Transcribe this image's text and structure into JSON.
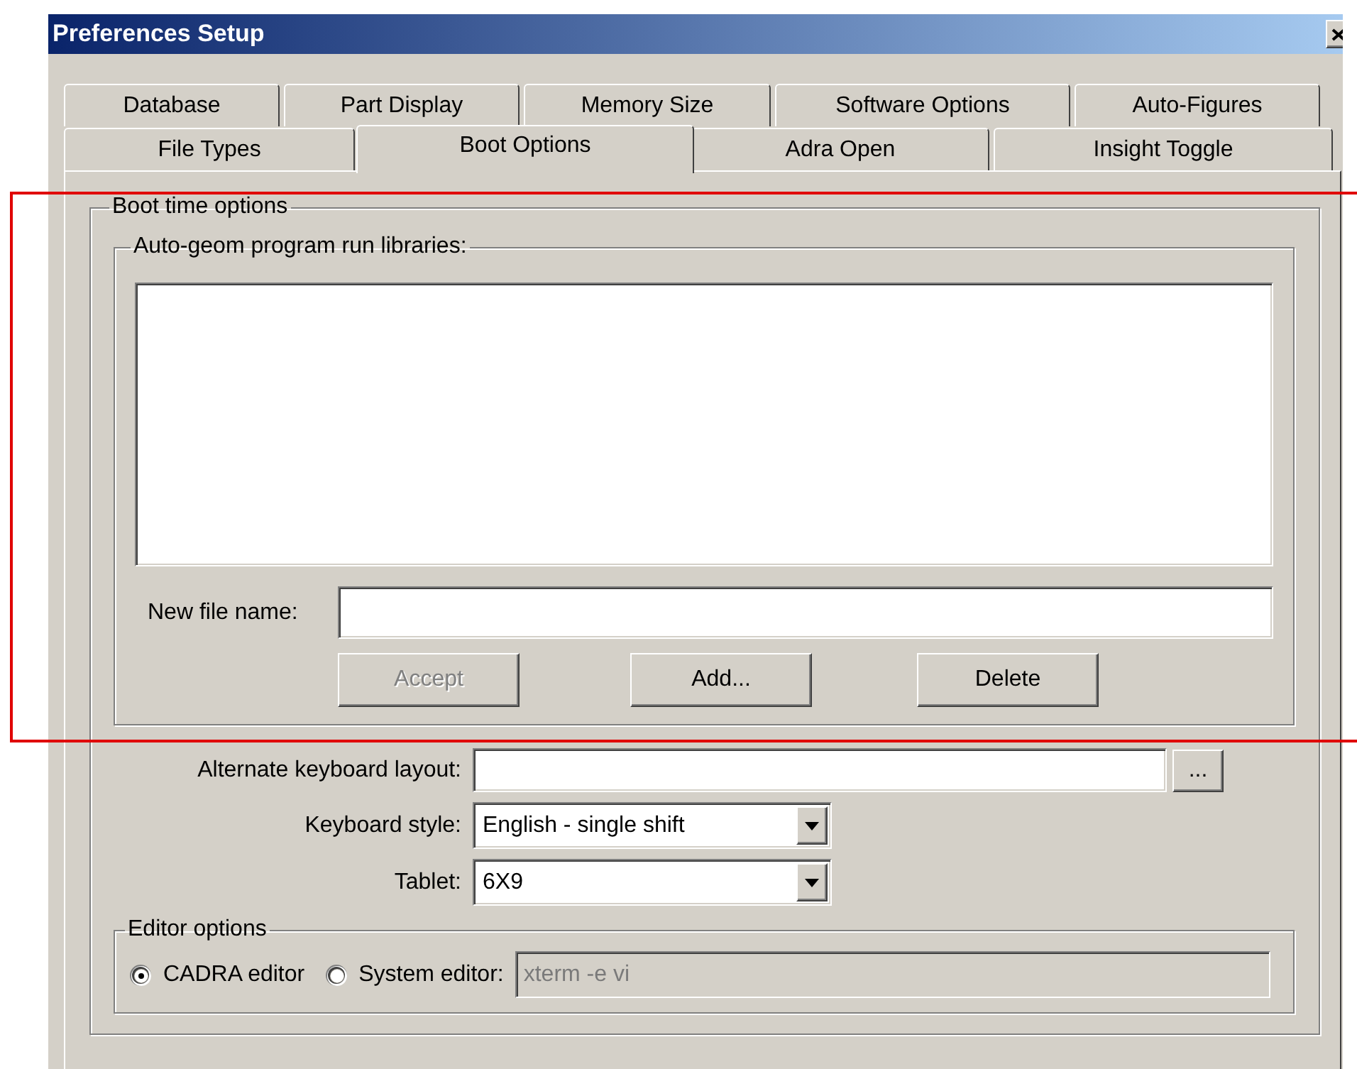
{
  "window": {
    "title": "Preferences Setup"
  },
  "tab_rows": [
    {
      "tabs": [
        {
          "label": "Database",
          "selected": false
        },
        {
          "label": "Part Display",
          "selected": false
        },
        {
          "label": "Memory Size",
          "selected": false
        },
        {
          "label": "Software Options",
          "selected": false
        },
        {
          "label": "Auto-Figures",
          "selected": false
        }
      ]
    },
    {
      "tabs": [
        {
          "label": "File Types",
          "selected": false
        },
        {
          "label": "Boot Options",
          "selected": true
        },
        {
          "label": "Adra Open",
          "selected": false
        },
        {
          "label": "Insight Toggle",
          "selected": false
        }
      ]
    }
  ],
  "boot_time_options": {
    "title": "Boot time options",
    "libraries": {
      "title": "Auto-geom program run libraries:"
    },
    "new_file_name": {
      "label": "New file name:"
    },
    "buttons": [
      {
        "label": "Accept",
        "disabled": true
      },
      {
        "label": "Add...",
        "disabled": false
      },
      {
        "label": "Delete",
        "disabled": false
      }
    ],
    "alternate_keyboard_layout": {
      "label": "Alternate keyboard layout:",
      "browse_button": "..."
    },
    "keyboard_style": {
      "label": "Keyboard style:",
      "value": "English - single shift"
    },
    "tablet": {
      "label": "Tablet:",
      "value": "6X9"
    },
    "editor_options": {
      "title": "Editor options",
      "choices": [
        {
          "label": "CADRA editor",
          "selected": true
        },
        {
          "label": "System editor:",
          "selected": false
        }
      ],
      "system_editor_command": {
        "value": "xterm -e vi",
        "disabled": true
      }
    }
  },
  "highlight": {
    "kind": "frame"
  }
}
